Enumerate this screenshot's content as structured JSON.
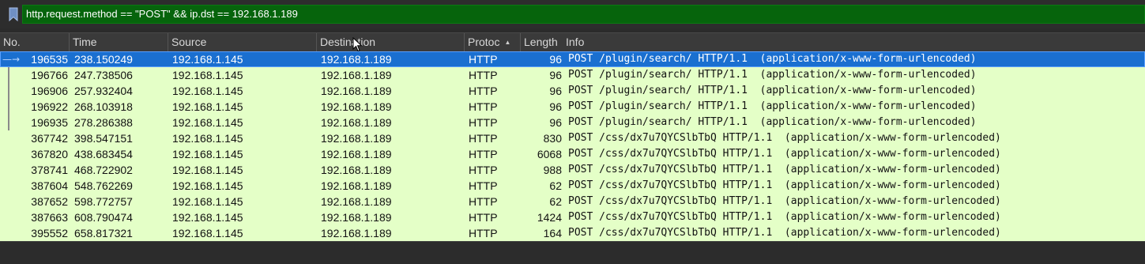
{
  "filter": {
    "text": "http.request.method == \"POST\" && ip.dst == 192.168.1.189",
    "valid_color": "#06640c"
  },
  "columns": [
    {
      "label": "No."
    },
    {
      "label": "Time"
    },
    {
      "label": "Source"
    },
    {
      "label": "Destination"
    },
    {
      "label": "Protoc",
      "sorted": "ascending"
    },
    {
      "label": "Length"
    },
    {
      "label": "Info"
    }
  ],
  "colors": {
    "row_bg": "#e4ffc7",
    "selected_bg": "#1a6fd0"
  },
  "packets": [
    {
      "no": "196535",
      "time": "238.150249",
      "src": "192.168.1.145",
      "dst": "192.168.1.189",
      "proto": "HTTP",
      "len": "96",
      "info": "POST /plugin/search/ HTTP/1.1  (application/x-www-form-urlencoded)",
      "selected": true,
      "related": true
    },
    {
      "no": "196766",
      "time": "247.738506",
      "src": "192.168.1.145",
      "dst": "192.168.1.189",
      "proto": "HTTP",
      "len": "96",
      "info": "POST /plugin/search/ HTTP/1.1  (application/x-www-form-urlencoded)",
      "related": true
    },
    {
      "no": "196906",
      "time": "257.932404",
      "src": "192.168.1.145",
      "dst": "192.168.1.189",
      "proto": "HTTP",
      "len": "96",
      "info": "POST /plugin/search/ HTTP/1.1  (application/x-www-form-urlencoded)",
      "related": true
    },
    {
      "no": "196922",
      "time": "268.103918",
      "src": "192.168.1.145",
      "dst": "192.168.1.189",
      "proto": "HTTP",
      "len": "96",
      "info": "POST /plugin/search/ HTTP/1.1  (application/x-www-form-urlencoded)",
      "related": true
    },
    {
      "no": "196935",
      "time": "278.286388",
      "src": "192.168.1.145",
      "dst": "192.168.1.189",
      "proto": "HTTP",
      "len": "96",
      "info": "POST /plugin/search/ HTTP/1.1  (application/x-www-form-urlencoded)",
      "related": true
    },
    {
      "no": "367742",
      "time": "398.547151",
      "src": "192.168.1.145",
      "dst": "192.168.1.189",
      "proto": "HTTP",
      "len": "830",
      "info": "POST /css/dx7u7QYCSlbTbQ HTTP/1.1  (application/x-www-form-urlencoded)"
    },
    {
      "no": "367820",
      "time": "438.683454",
      "src": "192.168.1.145",
      "dst": "192.168.1.189",
      "proto": "HTTP",
      "len": "6068",
      "info": "POST /css/dx7u7QYCSlbTbQ HTTP/1.1  (application/x-www-form-urlencoded)"
    },
    {
      "no": "378741",
      "time": "468.722902",
      "src": "192.168.1.145",
      "dst": "192.168.1.189",
      "proto": "HTTP",
      "len": "988",
      "info": "POST /css/dx7u7QYCSlbTbQ HTTP/1.1  (application/x-www-form-urlencoded)"
    },
    {
      "no": "387604",
      "time": "548.762269",
      "src": "192.168.1.145",
      "dst": "192.168.1.189",
      "proto": "HTTP",
      "len": "62",
      "info": "POST /css/dx7u7QYCSlbTbQ HTTP/1.1  (application/x-www-form-urlencoded)"
    },
    {
      "no": "387652",
      "time": "598.772757",
      "src": "192.168.1.145",
      "dst": "192.168.1.189",
      "proto": "HTTP",
      "len": "62",
      "info": "POST /css/dx7u7QYCSlbTbQ HTTP/1.1  (application/x-www-form-urlencoded)"
    },
    {
      "no": "387663",
      "time": "608.790474",
      "src": "192.168.1.145",
      "dst": "192.168.1.189",
      "proto": "HTTP",
      "len": "1424",
      "info": "POST /css/dx7u7QYCSlbTbQ HTTP/1.1  (application/x-www-form-urlencoded)"
    },
    {
      "no": "395552",
      "time": "658.817321",
      "src": "192.168.1.145",
      "dst": "192.168.1.189",
      "proto": "HTTP",
      "len": "164",
      "info": "POST /css/dx7u7QYCSlbTbQ HTTP/1.1  (application/x-www-form-urlencoded)"
    }
  ]
}
